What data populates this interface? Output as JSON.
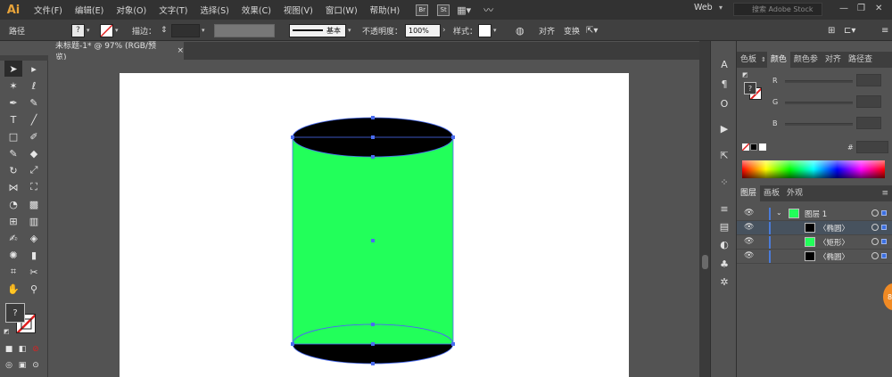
{
  "app": {
    "logo": "Ai",
    "menu": [
      "文件(F)",
      "编辑(E)",
      "对象(O)",
      "文字(T)",
      "选择(S)",
      "效果(C)",
      "视图(V)",
      "窗口(W)",
      "帮助(H)"
    ],
    "bridge_badge": "Br",
    "stock_badge": "St",
    "workspace": "Web",
    "stock_search_placeholder": "搜索 Adobe Stock"
  },
  "controlbar": {
    "selection_label": "路径",
    "stroke_label": "描边：",
    "stroke_style": "基本",
    "opacity_label": "不透明度：",
    "opacity_value": "100%",
    "style_label": "样式：",
    "align_label": "对齐",
    "transform_label": "变换"
  },
  "document": {
    "tab_title": "未标题-1* @ 97% (RGB/预览)",
    "close": "×"
  },
  "color_panel": {
    "tabs": [
      "色板",
      "颜色",
      "颜色参",
      "对齐",
      "路径查"
    ],
    "active_tab": 1,
    "sliders": [
      "R",
      "G",
      "B"
    ],
    "hex_label": "#"
  },
  "layers_panel": {
    "tabs": [
      "图层",
      "画板",
      "外观"
    ],
    "rows": [
      {
        "name": "图层 1",
        "thumb": "#22ff5a"
      },
      {
        "name": "〈椭圆〉",
        "thumb": "#000000"
      },
      {
        "name": "〈矩形〉",
        "thumb": "#22ff5a"
      },
      {
        "name": "〈椭圆〉",
        "thumb": "#000000"
      }
    ]
  },
  "artwork": {
    "rect_fill": "#22ff5a",
    "ellipse_fill": "#000000",
    "selection_color": "#4a6cf0"
  },
  "badge": "8"
}
